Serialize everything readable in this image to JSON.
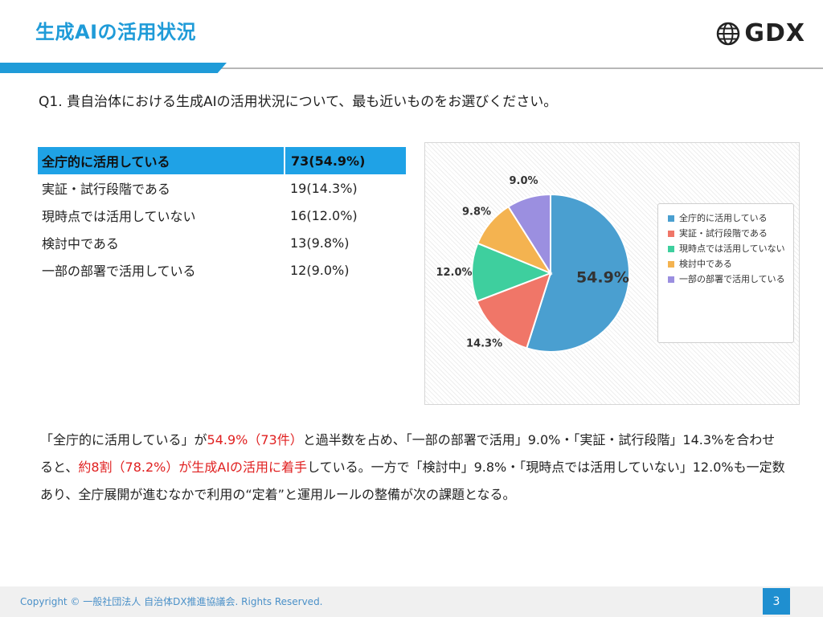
{
  "header": {
    "title": "生成AIの活用状況",
    "logo_text": "GDX",
    "logo_icon": "globe-icon"
  },
  "question": "Q1. 貴自治体における生成AIの活用状況について、最も近いものをお選びください。",
  "summary_table": [
    {
      "label": "全庁的に活用している",
      "value": "73(54.9%)"
    },
    {
      "label": "実証・試行段階である",
      "value": "19(14.3%)"
    },
    {
      "label": "現時点では活用していない",
      "value": "16(12.0%)"
    },
    {
      "label": "検討中である",
      "value": "13(9.8%)"
    },
    {
      "label": "一部の部署で活用している",
      "value": "12(9.0%)"
    }
  ],
  "chart_data": {
    "type": "pie",
    "categories": [
      "全庁的に活用している",
      "実証・試行段階である",
      "現時点では活用していない",
      "検討中である",
      "一部の部署で活用している"
    ],
    "values": [
      54.9,
      14.3,
      12.0,
      9.8,
      9.0
    ],
    "data_labels": [
      "54.9%",
      "14.3%",
      "12.0%",
      "9.8%",
      "9.0%"
    ],
    "colors": [
      "#4a9fd0",
      "#f07668",
      "#3ecf9e",
      "#f4b350",
      "#9b8fe0"
    ],
    "legend_position": "right",
    "start_angle": "top",
    "direction": "clockwise"
  },
  "analysis": {
    "p1": "「全庁的に活用している」が",
    "p2": "54.9%（73件）",
    "p3": "と過半数を占め、「一部の部署で活用」9.0%・「実証・試行段階」14.3%を合わせると、",
    "p4": "約8割（78.2%）が生成AIの活用に着手",
    "p5": "している。一方で「検討中」9.8%・「現時点では活用していない」12.0%も一定数あり、全庁展開が進むなかで利用の“定着”と運用ルールの整備が次の課題となる。"
  },
  "footer": {
    "copyright": "Copyright © 一般社団法人 自治体DX推進協議会. Rights Reserved.",
    "page_number": "3"
  }
}
